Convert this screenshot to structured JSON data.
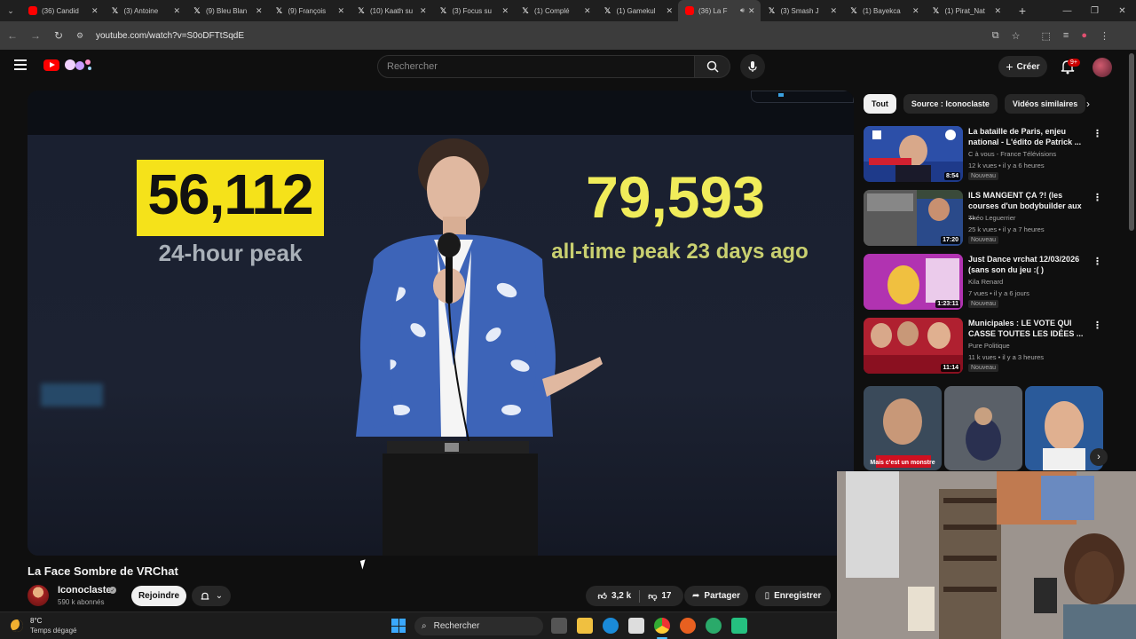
{
  "browser": {
    "tabs": [
      {
        "label": "(36) Candid",
        "icon": "youtube-icon"
      },
      {
        "label": "(3) Antoine",
        "icon": "x-icon"
      },
      {
        "label": "(9) Bleu Blan",
        "icon": "x-icon"
      },
      {
        "label": "(9) François",
        "icon": "x-icon"
      },
      {
        "label": "(10) Kaath su",
        "icon": "x-icon"
      },
      {
        "label": "(3) Focus su",
        "icon": "x-icon"
      },
      {
        "label": "(1) Complé",
        "icon": "x-icon"
      },
      {
        "label": "(1) Gamekul",
        "icon": "x-icon"
      },
      {
        "label": "(36) La F",
        "icon": "youtube-icon",
        "active": true
      },
      {
        "label": "(3) Smash J",
        "icon": "x-icon"
      },
      {
        "label": "(1) Bayekca",
        "icon": "x-icon"
      },
      {
        "label": "(1) Pirat_Nat",
        "icon": "x-icon"
      }
    ],
    "url": "youtube.com/watch?v=S0oDFTtSqdE"
  },
  "youtube": {
    "search_placeholder": "Rechercher",
    "create_label": "Créer",
    "notif_count": "9+",
    "brand_color": "#ff0000"
  },
  "video": {
    "overlay_left_num": "56,112",
    "overlay_left_sub": "24-hour peak",
    "overlay_right_num": "79,593",
    "overlay_right_sub": "all-time peak 23 days ago",
    "title": "La Face Sombre de VRChat",
    "channel": "Iconoclaste",
    "subscribers": "590 k abonnés",
    "join_label": "Rejoindre",
    "likes": "3,2 k",
    "dislikes": "17",
    "share_label": "Partager",
    "save_label": "Enregistrer"
  },
  "sidebar": {
    "chips": [
      "Tout",
      "Source : Iconoclaste",
      "Vidéos similaires"
    ],
    "recommendations": [
      {
        "title": "La bataille de Paris, enjeu national - L'édito de Patrick ...",
        "channel": "C à vous - France Télévisions",
        "meta": "12 k vues • il y a 6 heures",
        "badge": "Nouveau",
        "duration": "8:54"
      },
      {
        "title": "ILS MANGENT ÇA ?! (les courses d'un bodybuilder aux ...",
        "channel": "Théo Leguerrier",
        "meta": "25 k vues • il y a 7 heures",
        "badge": "Nouveau",
        "duration": "17:20"
      },
      {
        "title": "Just Dance vrchat 12/03/2026 (sans son du jeu :( )",
        "channel": "Kila Renard",
        "meta": "7 vues • il y a 6 jours",
        "badge": "Nouveau",
        "duration": "1:23:11"
      },
      {
        "title": "Municipales : LE VOTE QUI CASSE TOUTES LES IDÉES ...",
        "channel": "Pure Politique",
        "meta": "11 k vues • il y a 3 heures",
        "badge": "Nouveau",
        "duration": "11:14"
      }
    ],
    "shorts_caption": "Mais c'est un monstre"
  },
  "taskbar": {
    "temperature": "8°C",
    "weather": "Temps dégagé",
    "search_label": "Rechercher"
  }
}
